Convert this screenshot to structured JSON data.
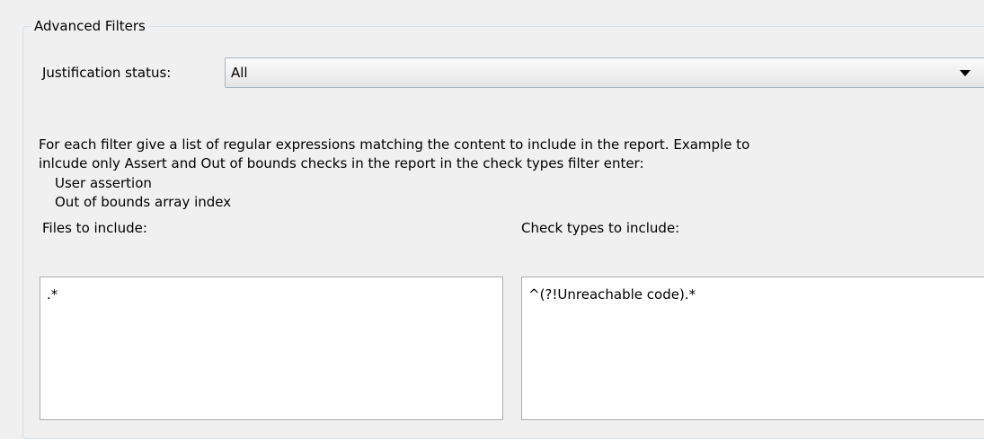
{
  "group": {
    "title": "Advanced Filters"
  },
  "justification": {
    "label": "Justification status:",
    "selected": "All"
  },
  "description": {
    "line1": "For each filter give a list of regular expressions matching the content to include in the report. Example to",
    "line2": "inlcude only Assert and Out of bounds checks in the report in the check types filter enter:",
    "example1": "User assertion",
    "example2": "Out of bounds array index"
  },
  "files": {
    "label": "Files to include:",
    "value": ".*"
  },
  "check_types": {
    "label": "Check types to include:",
    "value": "^(?!Unreachable code).*"
  },
  "icons": {
    "dropdown": "triangle-down-icon"
  }
}
